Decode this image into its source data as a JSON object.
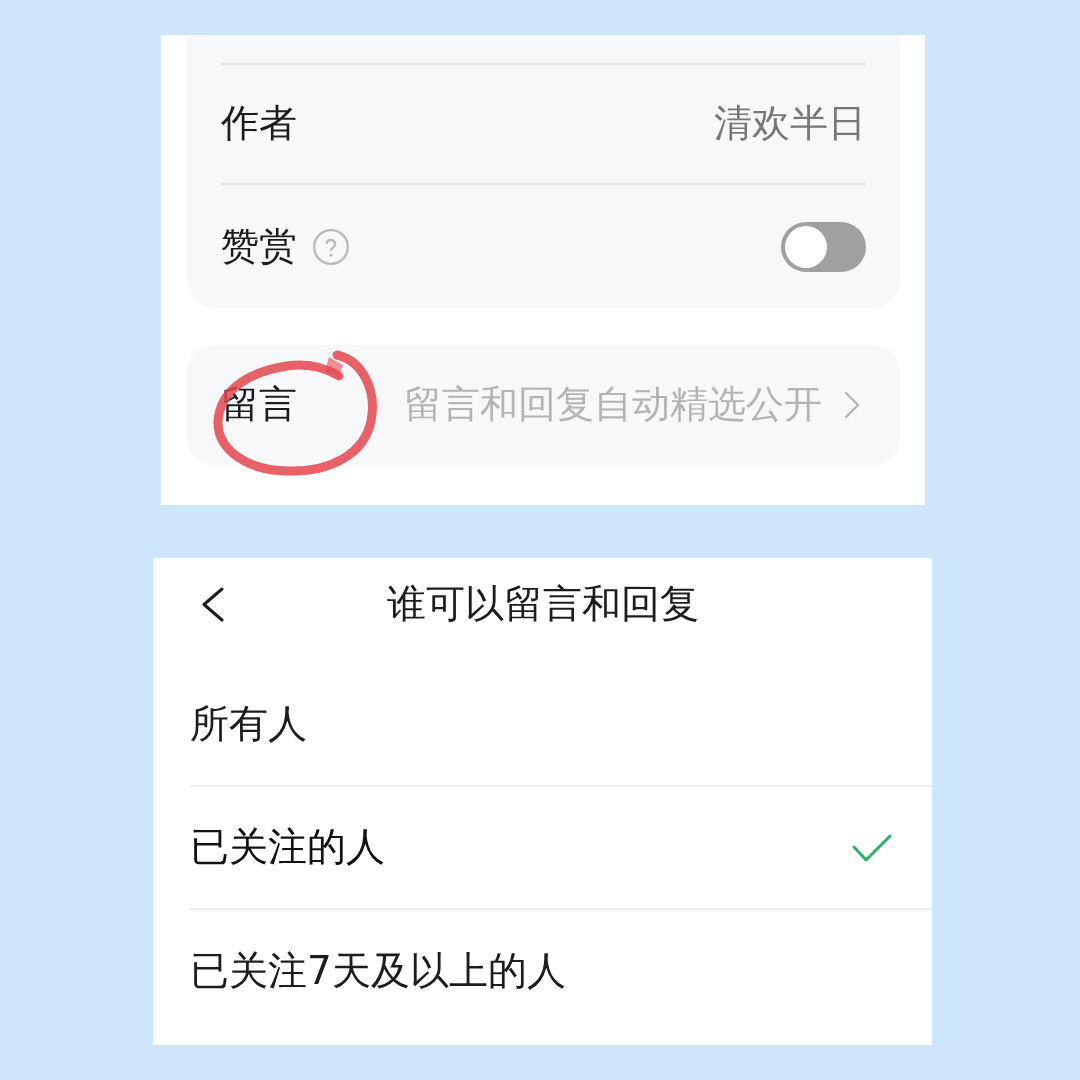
{
  "settings_panel": {
    "rows": [
      {
        "kind": "value",
        "label": "作者",
        "value": "清欢半日"
      },
      {
        "kind": "toggle",
        "label": "赞赏",
        "help": true,
        "on": false
      }
    ]
  },
  "comment_row": {
    "label": "留言",
    "value": "留言和回复自动精选公开",
    "circled": true
  },
  "reply_permission": {
    "title": "谁可以留言和回复",
    "options": [
      {
        "label": "所有人",
        "selected": false
      },
      {
        "label": "已关注的人",
        "selected": true
      },
      {
        "label": "已关注7天及以上的人",
        "selected": false
      }
    ]
  }
}
